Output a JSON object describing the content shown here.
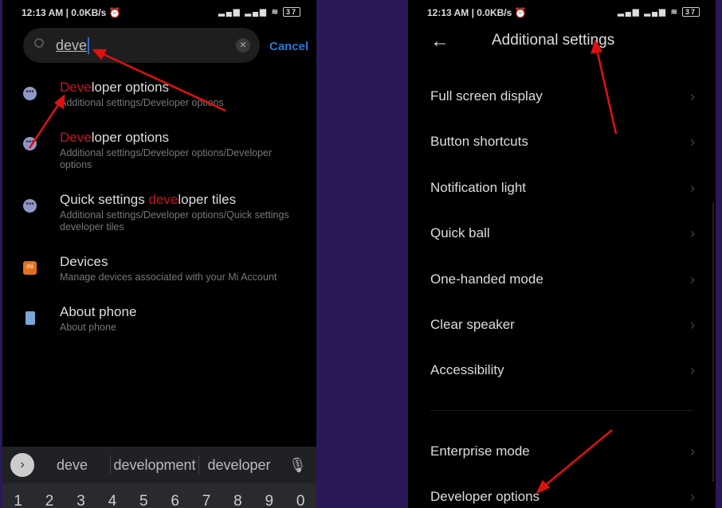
{
  "left": {
    "status": {
      "time": "12:13 AM | 0.0KB/s",
      "battery": "37"
    },
    "search": {
      "value": "deve",
      "cancel": "Cancel"
    },
    "results": [
      {
        "hl": "Deve",
        "rest": "loper options",
        "pre": "",
        "sub": "Additional settings/Developer options",
        "icon": "more-icon"
      },
      {
        "hl": "Deve",
        "rest": "loper options",
        "pre": "",
        "sub": "Additional settings/Developer options/Developer options",
        "icon": "more-icon"
      },
      {
        "pre": "Quick settings ",
        "hl": "deve",
        "rest": "loper tiles",
        "sub": "Additional settings/Developer options/Quick settings developer tiles",
        "icon": "more-icon"
      },
      {
        "pre": "Devices",
        "hl": "",
        "rest": "",
        "sub": "Manage devices associated with your Mi Account",
        "icon": "mi-icon"
      },
      {
        "pre": "About phone",
        "hl": "",
        "rest": "",
        "sub": "About phone",
        "icon": "phone-icon"
      }
    ],
    "suggestions": [
      "deve",
      "development",
      "developer"
    ],
    "keys": [
      "1",
      "2",
      "3",
      "4",
      "5",
      "6",
      "7",
      "8",
      "9",
      "0"
    ]
  },
  "right": {
    "status": {
      "time": "12:13 AM | 0.0KB/s",
      "battery": "37"
    },
    "title": "Additional settings",
    "items": [
      "Full screen display",
      "Button shortcuts",
      "Notification light",
      "Quick ball",
      "One-handed mode",
      "Clear speaker",
      "Accessibility"
    ],
    "items2": [
      "Enterprise mode",
      "Developer options"
    ]
  },
  "colors": {
    "background": "#2b1857",
    "highlight": "#c8141e",
    "accent": "#2a78d6",
    "arrow": "#e01010"
  }
}
